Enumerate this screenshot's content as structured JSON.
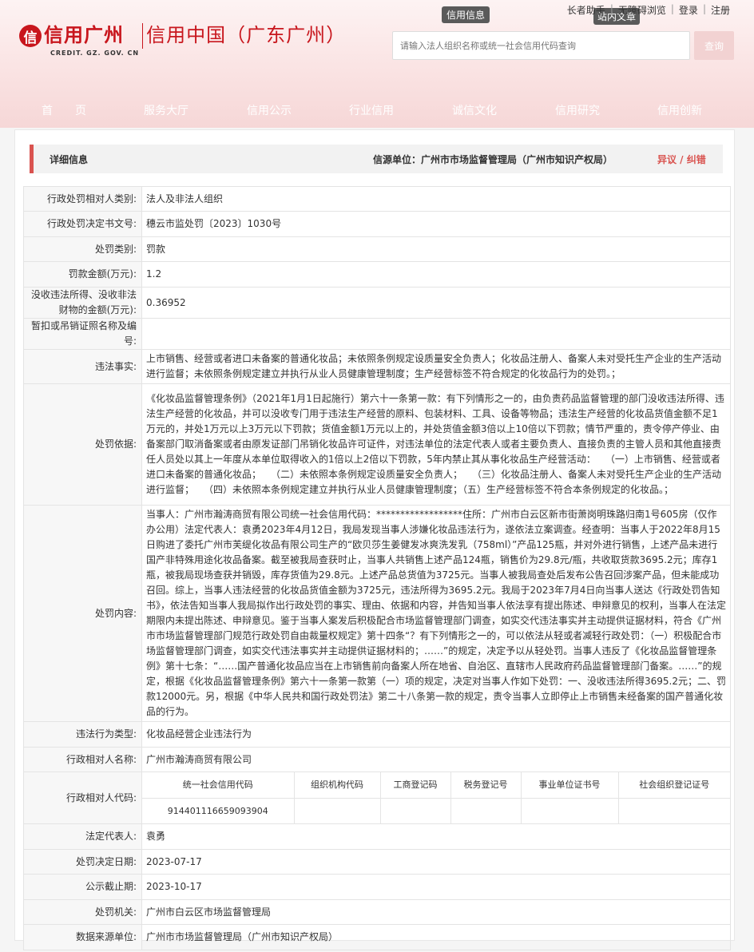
{
  "header": {
    "logo_mark": "信",
    "logo_text": "信用广州",
    "logo_en": "CREDIT. GZ. GOV. CN",
    "site_name": "信用中国（广东广州）",
    "tab_credit": "信用信息",
    "tab_site": "站内文章",
    "toplinks": [
      "长者助手",
      "无障碍浏览",
      "登录",
      "注册"
    ],
    "search_placeholder": "请输入法人组织名称或统一社会信用代码查询",
    "search_button": "查询"
  },
  "nav": [
    "首　　页",
    "服务大厅",
    "信用公示",
    "行业信用",
    "诚信文化",
    "信用研究",
    "信用创新"
  ],
  "panel": {
    "title": "详细信息",
    "source": "信源单位：广州市市场监督管理局（广州市知识产权局）",
    "objection": "异议 / 纠错"
  },
  "rows": [
    {
      "label": "行政处罚相对人类别:",
      "value": "法人及非法人组织"
    },
    {
      "label": "行政处罚决定书文号:",
      "value": "穗云市监处罚〔2023〕1030号"
    },
    {
      "label": "处罚类别:",
      "value": "罚款"
    },
    {
      "label": "罚款金额(万元):",
      "value": "1.2"
    },
    {
      "label": "没收违法所得、没收非法财物的金额(万元):",
      "value": "0.36952"
    },
    {
      "label": "暂扣或吊销证照名称及编号:",
      "value": ""
    },
    {
      "label": "违法事实:",
      "value": "上市销售、经营或者进口未备案的普通化妆品；未依照条例规定设质量安全负责人；化妆品注册人、备案人未对受托生产企业的生产活动进行监督；未依照条例规定建立并执行从业人员健康管理制度；生产经营标签不符合规定的化妆品行为的处罚。；"
    },
    {
      "label": "处罚依据:",
      "value": "《化妆品监督管理条例》（2021年1月1日起施行）第六十一条第一款：有下列情形之一的，由负责药品监督管理的部门没收违法所得、违法生产经营的化妆品，并可以没收专门用于违法生产经营的原料、包装材料、工具、设备等物品；违法生产经营的化妆品货值金额不足1万元的，并处1万元以上3万元以下罚款；货值金额1万元以上的，并处货值金额3倍以上10倍以下罚款；情节严重的，责令停产停业、由备案部门取消备案或者由原发证部门吊销化妆品许可证件，对违法单位的法定代表人或者主要负责人、直接负责的主管人员和其他直接责任人员处以其上一年度从本单位取得收入的1倍以上2倍以下罚款，5年内禁止其从事化妆品生产经营活动：　　（一）上市销售、经营或者进口未备案的普通化妆品；　　（二）未依照本条例规定设质量安全负责人；　　（三）化妆品注册人、备案人未对受托生产企业的生产活动进行监督；　　（四）未依照本条例规定建立并执行从业人员健康管理制度；（五）生产经营标签不符合本条例规定的化妆品。；"
    },
    {
      "label": "处罚内容:",
      "value": "当事人：广州市瀚涛商贸有限公司统一社会信用代码：******************住所：广州市白云区新市街萧岗明珠路归南1号605房（仅作办公用）法定代表人：袁勇2023年4月12日，我局发现当事人涉嫌化妆品违法行为，遂依法立案调查。经查明：当事人于2022年8月15日购进了委托广州市芙缇化妆品有限公司生产的“欧贝莎生姜健发冰爽洗发乳（758ml）”产品125瓶，并对外进行销售，上述产品未进行国产非特殊用途化妆品备案。截至被我局查获时止，当事人共销售上述产品124瓶，销售价为29.8元/瓶，共收取货款3695.2元；库存1瓶，被我局现场查获并销毁，库存货值为29.8元。上述产品总货值为3725元。当事人被我局查处后发布公告召回涉案产品，但未能成功召回。综上，当事人违法经营的化妆品货值金额为3725元，违法所得为3695.2元。我局于2023年7月4日向当事人送达《行政处罚告知书》，依法告知当事人我局拟作出行政处罚的事实、理由、依据和内容，并告知当事人依法享有提出陈述、申辩意见的权利，当事人在法定期限内未提出陈述、申辩意见。鉴于当事人案发后积极配合市场监督管理部门调查，如实交代违法事实并主动提供证据材料，符合《广州市市场监督管理部门规范行政处罚自由裁量权规定》第十四条“？有下列情形之一的，可以依法从轻或者减轻行政处罚：（一）积极配合市场监督管理部门调查，如实交代违法事实并主动提供证据材料的；……”的规定，决定予以从轻处罚。当事人违反了《化妆品监督管理条例》第十七条：“……国产普通化妆品应当在上市销售前向备案人所在地省、自治区、直辖市人民政府药品监督管理部门备案。……”的规定，根据《化妆品监督管理条例》第六十一条第一款第（一）项的规定，决定对当事人作如下处罚：一、没收违法所得3695.2元；二、罚款12000元。另，根据《中华人民共和国行政处罚法》第二十八条第一款的规定，责令当事人立即停止上市销售未经备案的国产普通化妆品的行为。"
    },
    {
      "label": "违法行为类型:",
      "value": "化妆品经营企业违法行为"
    },
    {
      "label": "行政相对人名称:",
      "value": "广州市瀚涛商贸有限公司"
    }
  ],
  "codes": {
    "label": "行政相对人代码:",
    "headers": [
      "统一社会信用代码",
      "组织机构代码",
      "工商登记码",
      "税务登记号",
      "事业单位证书号",
      "社会组织登记证号"
    ],
    "values": [
      "914401116659093904",
      "",
      "",
      "",
      "",
      ""
    ]
  },
  "rows_after": [
    {
      "label": "法定代表人:",
      "value": "袁勇"
    },
    {
      "label": "处罚决定日期:",
      "value": "2023-07-17"
    },
    {
      "label": "公示截止期:",
      "value": "2023-10-17"
    },
    {
      "label": "处罚机关:",
      "value": "广州市白云区市场监督管理局"
    },
    {
      "label": "数据来源单位:",
      "value": "广州市市场监督管理局（广州市知识产权局）"
    }
  ]
}
